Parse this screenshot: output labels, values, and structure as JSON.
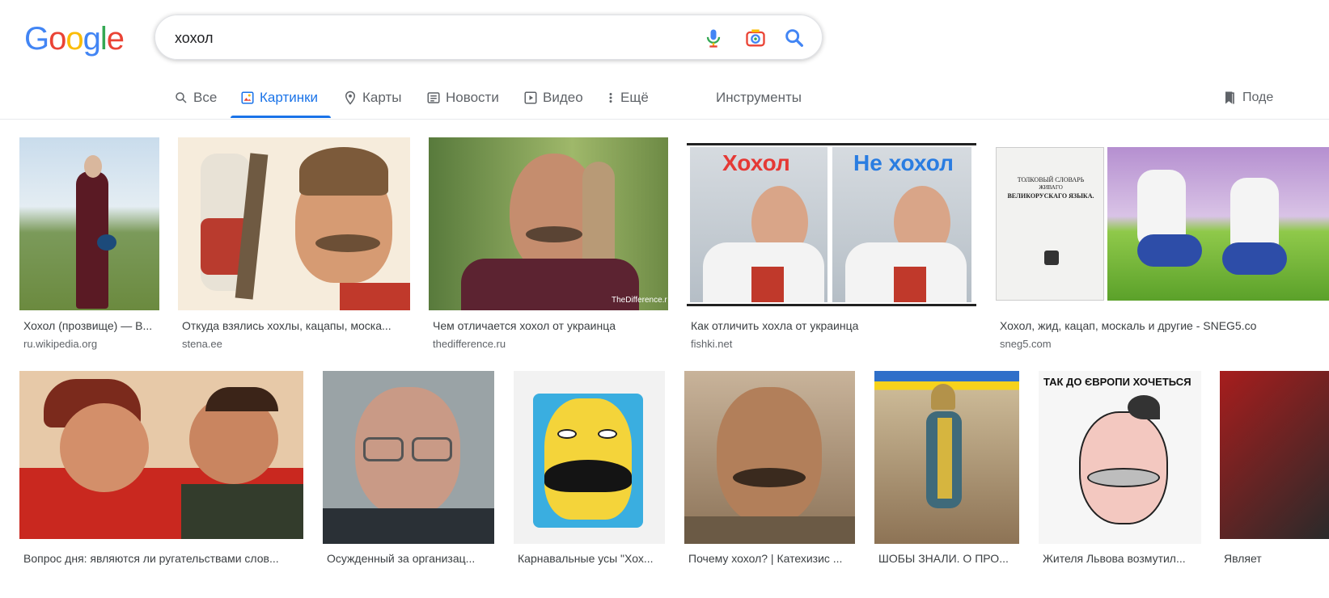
{
  "search": {
    "query": "хохол"
  },
  "tabs": [
    {
      "label": "Все",
      "icon": "search-icon"
    },
    {
      "label": "Картинки",
      "icon": "image-icon",
      "active": true
    },
    {
      "label": "Карты",
      "icon": "map-pin-icon"
    },
    {
      "label": "Новости",
      "icon": "news-icon"
    },
    {
      "label": "Видео",
      "icon": "video-icon"
    },
    {
      "label": "Ещё",
      "icon": "more-vert-icon"
    }
  ],
  "tools_label": "Инструменты",
  "saved_label": "Поде",
  "colors": {
    "accent": "#1a73e8",
    "text_secondary": "#5f6368",
    "border": "#dfe1e5"
  },
  "results_row1": [
    {
      "caption": "Хохол (прозвище) — В...",
      "domain": "ru.wikipedia.org"
    },
    {
      "caption": "Откуда взялись хохлы, кацапы, моска...",
      "domain": "stena.ee"
    },
    {
      "caption": "Чем отличается хохол от украинца",
      "domain": "thedifference.ru",
      "overlay": "TheDifference.r"
    },
    {
      "caption": "Как отличить хохла от украинца",
      "domain": "fishki.net",
      "overlay_left": "Хохол",
      "overlay_right": "Не хохол"
    },
    {
      "caption": "Хохол, жид, кацап, москаль и другие - SNEG5.co",
      "domain": "sneg5.com",
      "overlay_line1": "ТОЛКОВЫЙ СЛОВАРЬ",
      "overlay_line2": "ЖИВАГО",
      "overlay_line3": "ВЕЛИКОРУСКАГО ЯЗЫКА."
    }
  ],
  "results_row2": [
    {
      "caption": "Вопрос дня: являются ли ругательствами слов..."
    },
    {
      "caption": "Осужденный за организац..."
    },
    {
      "caption": "Карнавальные усы \"Хох..."
    },
    {
      "caption": "Почему хохол? | Катехизис ..."
    },
    {
      "caption": "ШОБЫ ЗНАЛИ. О ПРО..."
    },
    {
      "caption": "Жителя Львова возмутил...",
      "overlay": "ТАК ДО ЄВРОПИ ХОЧЕТЬСЯ"
    },
    {
      "caption": "Являет"
    }
  ]
}
